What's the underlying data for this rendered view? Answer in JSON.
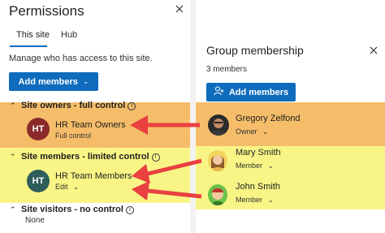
{
  "permissions": {
    "title": "Permissions",
    "tabs": [
      {
        "label": "This site"
      },
      {
        "label": "Hub"
      }
    ],
    "description": "Manage who has access to this site.",
    "add_members_label": "Add members",
    "sections": [
      {
        "header": "Site owners - full control",
        "members": [
          {
            "initials": "HT",
            "name": "HR Team Owners",
            "role": "Full control"
          }
        ]
      },
      {
        "header": "Site members - limited control",
        "members": [
          {
            "initials": "HT",
            "name": "HR Team Members",
            "role": "Edit"
          }
        ]
      },
      {
        "header": "Site visitors - no control",
        "empty_text": "None"
      }
    ]
  },
  "group_membership": {
    "title": "Group membership",
    "count": "3 members",
    "add_members_label": "Add members",
    "members": [
      {
        "name": "Gregory Zelfond",
        "role": "Owner"
      },
      {
        "name": "Mary Smith",
        "role": "Member"
      },
      {
        "name": "John Smith",
        "role": "Member"
      }
    ]
  },
  "colors": {
    "accent": "#0f6cbd",
    "owners_highlight": "#f5bd6a",
    "members_highlight": "#f8f586",
    "arrow": "#e94040",
    "owners_avatar": "#8a2a2a",
    "members_avatar": "#2f5d5a"
  }
}
